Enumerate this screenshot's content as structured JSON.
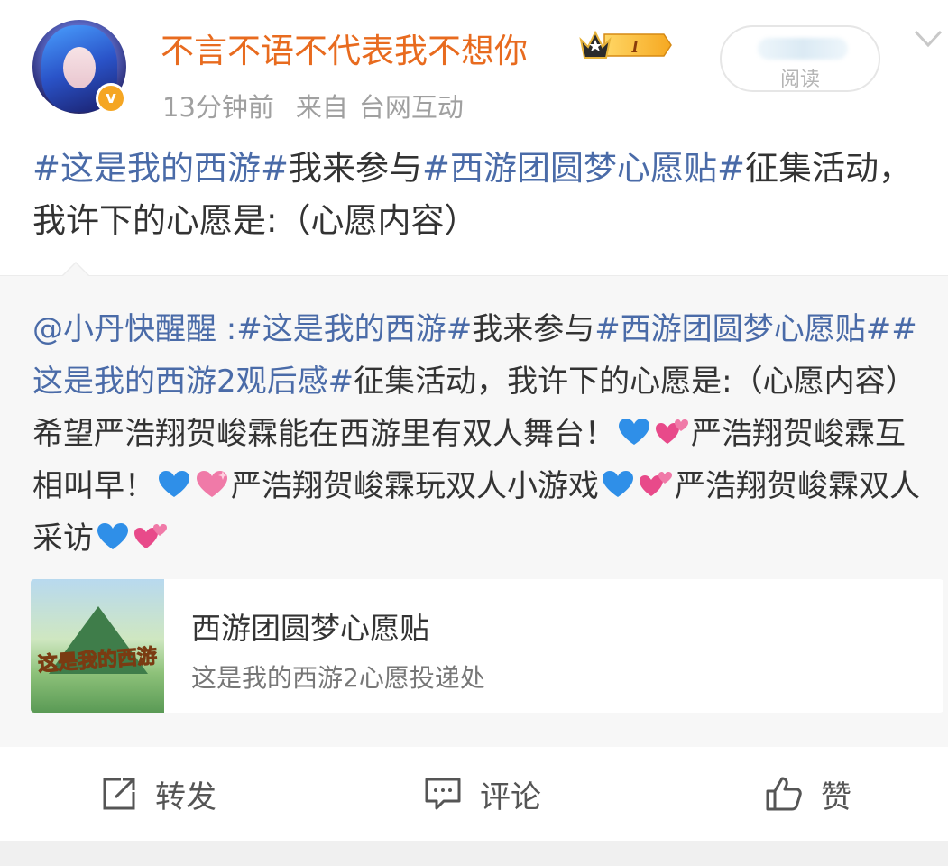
{
  "user": {
    "name": "不言不语不代表我不想你",
    "vip_level": "I"
  },
  "meta": {
    "time": "13分钟前",
    "source_prefix": "来自",
    "source": "台网互动"
  },
  "read_button": {
    "label": "阅读"
  },
  "post": {
    "tag1": "#这是我的西游#",
    "text1": "我来参与",
    "tag2": "#西游团圆梦心愿贴#",
    "text2": "征集活动，我许下的心愿是:（心愿内容）"
  },
  "repost": {
    "mention": "@小丹快醒醒",
    "sep": " :",
    "tag1": "#这是我的西游#",
    "text1": "我来参与",
    "tag2": "#西游团圆梦心愿贴#",
    "tag3": "#这是我的西游2观后感#",
    "text2": "征集活动，我许下的心愿是:（心愿内容）希望严浩翔贺峻霖能在西游里有双人舞台！",
    "text3": "严浩翔贺峻霖互相叫早！",
    "text4": "严浩翔贺峻霖玩双人小游戏",
    "text5": "严浩翔贺峻霖双人采访"
  },
  "card": {
    "title": "西游团圆梦心愿贴",
    "subtitle": "这是我的西游2心愿投递处",
    "thumb_text": "这是我的西游"
  },
  "actions": {
    "repost": "转发",
    "comment": "评论",
    "like": "赞"
  },
  "colors": {
    "username": "#e86b1f",
    "tag": "#4a6ba8",
    "verify": "#f5a623"
  }
}
